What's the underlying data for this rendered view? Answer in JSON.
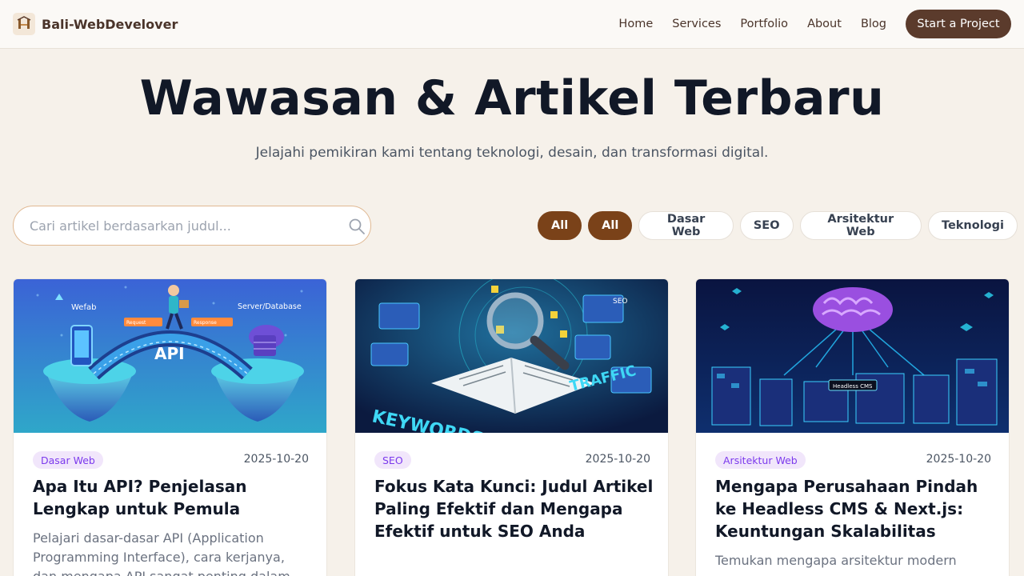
{
  "nav": {
    "brand": "Bali-WebDevelover",
    "links": [
      "Home",
      "Services",
      "Portfolio",
      "About",
      "Blog"
    ],
    "cta": "Start a Project"
  },
  "hero": {
    "title": "Wawasan & Artikel Terbaru",
    "subtitle": "Jelajahi pemikiran kami tentang teknologi, desain, dan transformasi digital."
  },
  "search": {
    "placeholder": "Cari artikel berdasarkan judul...",
    "icon": "search-icon"
  },
  "filters": [
    {
      "label": "All",
      "active": true
    },
    {
      "label": "All",
      "active": true
    },
    {
      "label": "Dasar Web",
      "active": false
    },
    {
      "label": "SEO",
      "active": false
    },
    {
      "label": "Arsitektur Web",
      "active": false
    },
    {
      "label": "Teknologi",
      "active": false
    }
  ],
  "articles": [
    {
      "category": "Dasar Web",
      "date": "2025-10-20",
      "title": "Apa Itu API? Penjelasan Lengkap untuk Pemula",
      "excerpt": "Pelajari dasar-dasar API (Application Programming Interface), cara kerjanya, dan mengapa API sangat penting dalam",
      "image_text": {
        "brand": "Wefab",
        "server": "Server/Database",
        "request": "Request",
        "response": "Response",
        "api": "API"
      }
    },
    {
      "category": "SEO",
      "date": "2025-10-20",
      "title": "Fokus Kata Kunci: Judul Artikel Paling Efektif dan Mengapa Efektif untuk SEO Anda",
      "excerpt": "",
      "image_text": {
        "seo": "SEO",
        "keyword": "KEYWORDS",
        "traffic": "TRAFFIC"
      }
    },
    {
      "category": "Arsitektur Web",
      "date": "2025-10-20",
      "title": "Mengapa Perusahaan Pindah ke Headless CMS & Next.js: Keuntungan Skalabilitas",
      "excerpt": "Temukan mengapa arsitektur modern",
      "image_text": {
        "label": "Headless CMS"
      }
    }
  ],
  "colors": {
    "accent": "#7a4219",
    "cta": "#5b3b2c",
    "background": "#f6f1ea",
    "badge_bg": "#f1e6fb",
    "badge_text": "#7c3aed"
  }
}
